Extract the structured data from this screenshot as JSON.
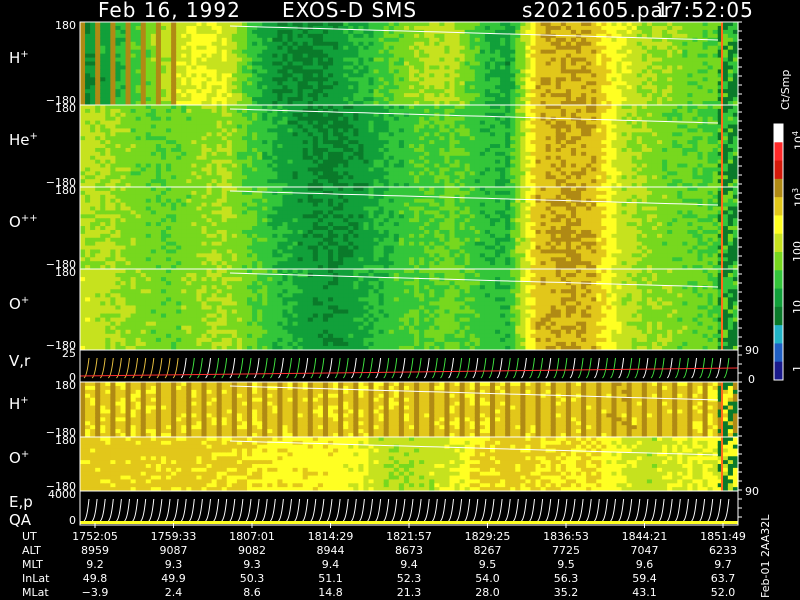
{
  "header": {
    "date": "Feb 16, 1992",
    "mission": "EXOS-D SMS",
    "file": "s2021605.par",
    "time": "17:52:05"
  },
  "colors": {
    "gradient": [
      "#1a1a8c",
      "#1f5fc4",
      "#22b4c8",
      "#0a7a2a",
      "#11a03a",
      "#33c63a",
      "#77d81e",
      "#c6e21e",
      "#ffff22",
      "#e2c71a",
      "#b08a14",
      "#d41a0a",
      "#ff2a2a",
      "#ffffff"
    ]
  },
  "chart_data": [
    {
      "type": "heatmap",
      "panel": "H+",
      "label_main": "H",
      "label_sup": "+",
      "yticks": [
        "180",
        "−180"
      ],
      "ylim": [
        -180,
        180
      ],
      "ylabel": "",
      "trend": [
        0.1,
        0.22,
        0.36,
        0.55,
        0.66,
        0.62,
        0.3,
        0.12,
        0.1,
        0.18,
        0.28,
        0.4,
        0.52,
        0.55,
        0.32,
        0.18,
        0.82,
        0.88,
        0.85,
        0.62,
        0.5,
        0.45,
        0.4,
        0.35
      ],
      "striped_segment": [
        0.0,
        0.14
      ]
    },
    {
      "type": "heatmap",
      "panel": "He+",
      "label_main": "He",
      "label_sup": "+",
      "yticks": [
        "180",
        "−180"
      ],
      "ylim": [
        -180,
        180
      ],
      "ylabel": "",
      "trend": [
        0.55,
        0.5,
        0.42,
        0.4,
        0.45,
        0.5,
        0.35,
        0.22,
        0.12,
        0.1,
        0.18,
        0.28,
        0.35,
        0.38,
        0.3,
        0.25,
        0.82,
        0.88,
        0.85,
        0.55,
        0.45,
        0.4,
        0.38,
        0.35
      ],
      "striped_segment": null
    },
    {
      "type": "heatmap",
      "panel": "O++",
      "label_main": "O",
      "label_sup": "++",
      "yticks": [
        "180",
        "−180"
      ],
      "ylim": [
        -180,
        180
      ],
      "ylabel": "",
      "trend": [
        0.55,
        0.5,
        0.44,
        0.4,
        0.45,
        0.5,
        0.38,
        0.25,
        0.15,
        0.12,
        0.2,
        0.3,
        0.36,
        0.4,
        0.3,
        0.26,
        0.82,
        0.88,
        0.84,
        0.55,
        0.46,
        0.42,
        0.38,
        0.35
      ],
      "striped_segment": null
    },
    {
      "type": "heatmap",
      "panel": "O+",
      "label_main": "O",
      "label_sup": "+",
      "yticks": [
        "180",
        "−180"
      ],
      "ylim": [
        -180,
        180
      ],
      "ylabel": "",
      "trend": [
        0.58,
        0.52,
        0.46,
        0.42,
        0.46,
        0.52,
        0.4,
        0.28,
        0.18,
        0.15,
        0.24,
        0.32,
        0.38,
        0.42,
        0.32,
        0.28,
        0.82,
        0.88,
        0.84,
        0.56,
        0.48,
        0.44,
        0.4,
        0.36
      ],
      "striped_segment": null
    },
    {
      "type": "line",
      "panel": "V,r",
      "label_main": "V,r",
      "yticks": [
        "25",
        "0"
      ],
      "right_ticks": [
        "90",
        "0"
      ],
      "ylim": [
        0,
        25
      ]
    },
    {
      "type": "heatmap",
      "panel": "H+ (lower)",
      "label_main": "H",
      "label_sup": "+",
      "yticks": [
        "180",
        "−180"
      ],
      "ylim": [
        -180,
        180
      ],
      "ylabel": "",
      "trend": [
        0.78,
        0.78,
        0.78,
        0.8,
        0.8,
        0.78,
        0.76,
        0.78,
        0.8,
        0.78,
        0.76,
        0.78,
        0.8,
        0.78,
        0.76,
        0.78,
        0.8,
        0.78,
        0.8,
        0.82,
        0.8,
        0.78,
        0.76,
        0.7
      ],
      "striped_segment": [
        0.0,
        1.0
      ]
    },
    {
      "type": "heatmap",
      "panel": "O+ (lower)",
      "label_main": "O",
      "label_sup": "+",
      "yticks": [
        "180",
        "−180"
      ],
      "ylim": [
        -180,
        180
      ],
      "ylabel": "",
      "trend": [
        0.8,
        0.8,
        0.8,
        0.78,
        0.8,
        0.76,
        0.74,
        0.7,
        0.72,
        0.7,
        0.6,
        0.52,
        0.55,
        0.6,
        0.75,
        0.8,
        0.76,
        0.74,
        0.76,
        0.6,
        0.55,
        0.62,
        0.65,
        0.65
      ],
      "striped_segment": null
    },
    {
      "type": "line",
      "panel": "E,p QA",
      "label_main": "E,p",
      "label_second": "QA",
      "yticks": [
        "4000",
        "0"
      ],
      "right_ticks": [
        "90"
      ],
      "ylim": [
        0,
        4000
      ]
    }
  ],
  "colorbar": {
    "unit_label": "Ct/Smp",
    "ticks": [
      {
        "base": "10",
        "exp": "4"
      },
      {
        "base": "10",
        "exp": "3"
      },
      {
        "base": "100",
        "exp": ""
      },
      {
        "base": "10",
        "exp": ""
      },
      {
        "base": "1",
        "exp": ""
      }
    ]
  },
  "table": {
    "rows": [
      {
        "label": "UT",
        "values": [
          "1752:05",
          "1759:33",
          "1807:01",
          "1814:29",
          "1821:57",
          "1829:25",
          "1836:53",
          "1844:21",
          "1851:49"
        ]
      },
      {
        "label": "ALT",
        "values": [
          "8959",
          "9087",
          "9082",
          "8944",
          "8673",
          "8267",
          "7725",
          "7047",
          "6233"
        ]
      },
      {
        "label": "MLT",
        "values": [
          "9.2",
          "9.3",
          "9.3",
          "9.4",
          "9.4",
          "9.5",
          "9.5",
          "9.6",
          "9.7"
        ]
      },
      {
        "label": "InLat",
        "values": [
          "49.8",
          "49.9",
          "50.3",
          "51.1",
          "52.3",
          "54.0",
          "56.3",
          "59.4",
          "63.7"
        ]
      },
      {
        "label": "MLat",
        "values": [
          "−3.9",
          "2.4",
          "8.6",
          "14.8",
          "21.3",
          "28.0",
          "35.2",
          "43.1",
          "52.0"
        ]
      }
    ],
    "footer": "Feb-01 2AA32L"
  }
}
